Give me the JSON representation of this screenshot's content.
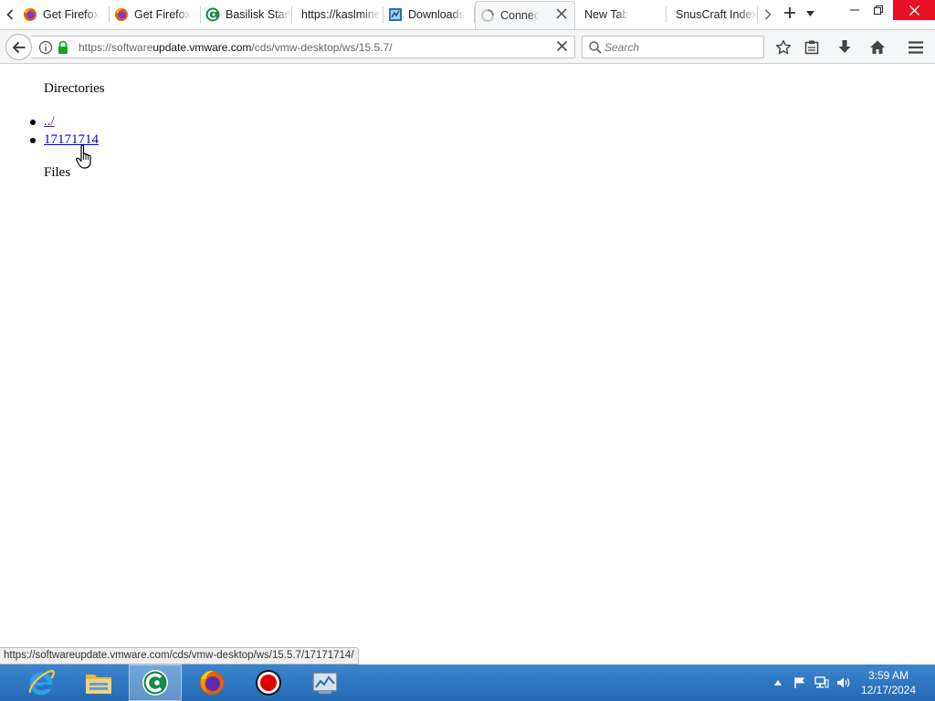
{
  "browser": {
    "tabs": [
      {
        "label": "Get Firefox",
        "icon": "firefox-icon",
        "active": false
      },
      {
        "label": "Get Firefox",
        "icon": "firefox-icon",
        "active": false
      },
      {
        "label": "Basilisk Start",
        "icon": "basilisk-icon",
        "active": false
      },
      {
        "label": "https://kaslmine",
        "icon": "",
        "active": false
      },
      {
        "label": "Downloads",
        "icon": "download-page-icon",
        "active": false
      },
      {
        "label": "Connecting",
        "icon": "loading-spinner-icon",
        "active": true
      },
      {
        "label": "New Tab",
        "icon": "",
        "active": false
      },
      {
        "label": "SnusCraft Index",
        "icon": "",
        "active": false
      }
    ],
    "url": {
      "prefix": "https://software",
      "host": "update.vmware.com",
      "path": "/cds/vmw-desktop/ws/15.5.7/"
    },
    "search": {
      "placeholder": "Search"
    }
  },
  "page": {
    "directories_heading": "Directories",
    "directories": [
      {
        "label": "../",
        "visited": true
      },
      {
        "label": "17171714",
        "visited": false
      }
    ],
    "files_heading": "Files"
  },
  "status_bar": {
    "link_url": "https://softwareupdate.vmware.com/cds/vmw-desktop/ws/15.5.7/17171714/"
  },
  "taskbar": {
    "apps": [
      {
        "name": "internet-explorer",
        "active": false
      },
      {
        "name": "file-explorer",
        "active": false
      },
      {
        "name": "basilisk",
        "active": true
      },
      {
        "name": "firefox",
        "active": false
      },
      {
        "name": "recorder",
        "active": false
      },
      {
        "name": "control-panel",
        "active": false
      }
    ],
    "clock": {
      "time": "3:59 AM",
      "date": "12/17/2024"
    }
  },
  "colors": {
    "taskbar": "#2b75c0",
    "close_button": "#e81123",
    "link": "#0000ee",
    "visited_link": "#551a8b"
  }
}
